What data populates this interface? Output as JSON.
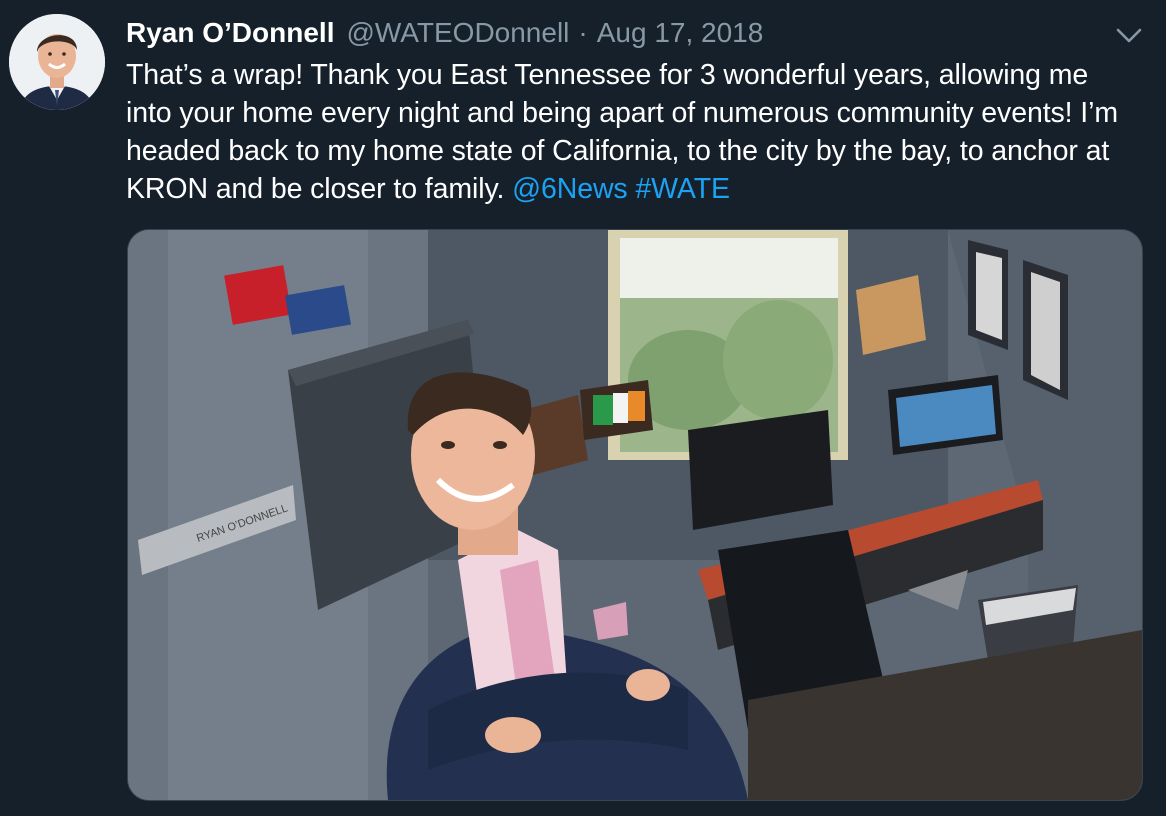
{
  "author": {
    "display_name": "Ryan O’Donnell",
    "handle": "@WATEODonnell",
    "separator": "·",
    "date": "Aug 17, 2018",
    "avatar_icon": "profile-avatar"
  },
  "tweet": {
    "text": "That’s a wrap! Thank you East Tennessee for 3 wonderful years, allowing me into your home every night and being apart of numerous community events! I’m headed back to my home state of California, to the city by the bay, to anchor at KRON and be closer to family.",
    "mention": "@6News",
    "hashtag": "#WATE"
  },
  "media": {
    "type": "photo",
    "nameplate_text": "RYAN O’DONNELL"
  },
  "menu": {
    "icon": "chevron-down-icon"
  },
  "colors": {
    "background": "#15202b",
    "text": "#ffffff",
    "secondary": "#8899a6",
    "link": "#1da1f2"
  }
}
